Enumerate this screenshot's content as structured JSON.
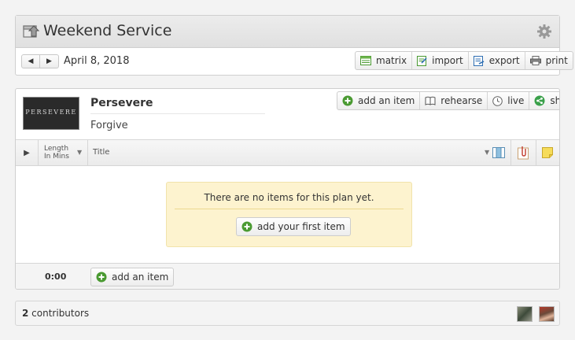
{
  "service": {
    "title": "Weekend Service",
    "icon": "service-type-icon",
    "settings_icon": "gear-icon"
  },
  "date_nav": {
    "prev_label": "◀",
    "next_label": "▶",
    "date": "April 8, 2018"
  },
  "top_actions": [
    {
      "label": "matrix",
      "icon": "matrix-icon"
    },
    {
      "label": "import",
      "icon": "import-icon"
    },
    {
      "label": "export",
      "icon": "export-icon"
    },
    {
      "label": "print",
      "icon": "printer-icon"
    }
  ],
  "plan": {
    "series_title": "Persevere",
    "thumbnail_text": "PERSEVERE",
    "title": "Forgive",
    "actions": [
      {
        "label": "add an item",
        "icon": "add-icon"
      },
      {
        "label": "rehearse",
        "icon": "book-icon"
      },
      {
        "label": "live",
        "icon": "clock-icon"
      },
      {
        "label": "share",
        "icon": "share-icon"
      }
    ],
    "columns": {
      "play": "▶",
      "length_line1": "Length",
      "length_line2": "In Mins",
      "title": "Title"
    },
    "empty": {
      "message": "There are no items for this plan yet.",
      "button": "add your first item"
    },
    "footer": {
      "total_length": "0:00",
      "add_button": "add an item"
    }
  },
  "contributors": {
    "count": "2",
    "label": " contributors"
  },
  "colors": {
    "accent_green": "#4a9a32",
    "empty_bg": "#fdf3cf",
    "panel_border": "#cfcfcf"
  }
}
